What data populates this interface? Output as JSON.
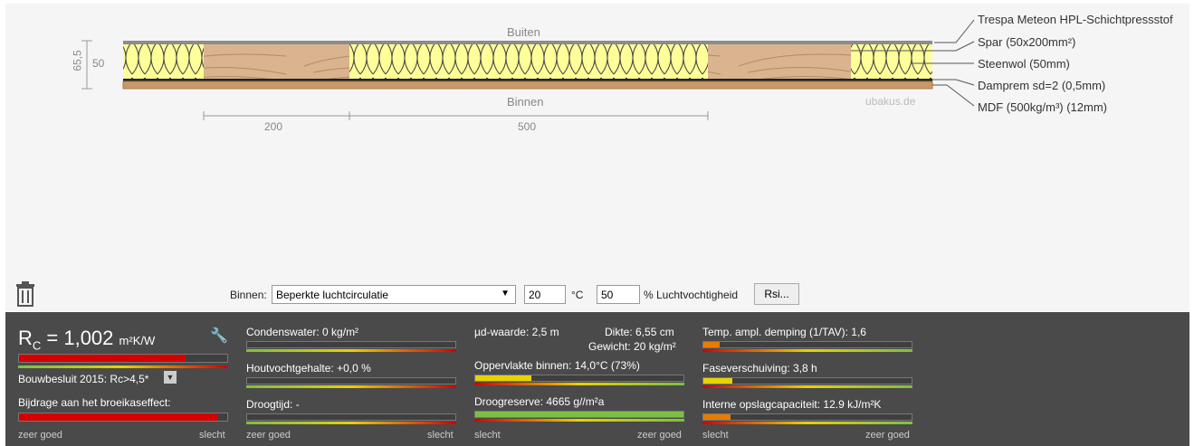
{
  "diagram": {
    "top_label": "Buiten",
    "bottom_label": "Binnen",
    "watermark": "ubakus.de",
    "dim_height_total": "65,5",
    "dim_height_layer": "50",
    "dim_widths": [
      "200",
      "500"
    ],
    "layers": [
      "Trespa Meteon HPL-Schichtpressstof",
      "Spar (50x200mm²)",
      "Steenwol (50mm)",
      "Damprem sd=2 (0,5mm)",
      "MDF (500kg/m³) (12mm)"
    ]
  },
  "controls": {
    "binnen_label": "Binnen:",
    "air_select": "Beperkte luchtcirculatie",
    "temp_value": "20",
    "temp_unit": "°C",
    "humidity_value": "50",
    "humidity_unit": "% Luchtvochtigheid",
    "rsi_button": "Rsi..."
  },
  "results": {
    "rc_prefix": "R",
    "rc_sub": "C",
    "rc_value": " = 1,002",
    "rc_unit": "m²K/W",
    "norm": "Bouwbesluit 2015: Rc>4,5*",
    "greenhouse": "Bijdrage aan het broeikaseffect:",
    "scale_left_1": "zeer goed",
    "scale_right_1": "slecht",
    "condensation": "Condenswater: 0 kg/m²",
    "wood_moisture": "Houtvochtgehalte: +0,0 %",
    "drying_time": "Droogtijd: -",
    "scale_left_2": "zeer goed",
    "scale_right_2": "slecht",
    "mu_value": "µd-waarde: 2,5 m",
    "thickness": "Dikte: 6,55 cm",
    "weight": "Gewicht: 20 kg/m²",
    "surface_inside": "Oppervlakte binnen: 14,0°C (73%)",
    "drying_reserve": "Droogreserve: 4665 g//m²a",
    "scale_left_3": "slecht",
    "scale_right_3": "zeer goed",
    "temp_ampl": "Temp. ampl. demping (1/TAV): 1,6",
    "phase_shift": "Faseverschuiving: 3,8 h",
    "heat_capacity": "Interne opslagcapaciteit: 12.9 kJ/m²K",
    "scale_left_4": "slecht",
    "scale_right_4": "zeer goed"
  },
  "levels": {
    "rc": 0.8,
    "greenhouse": 0.95,
    "condensation": 0.0,
    "wood_moisture": 0.0,
    "drying_time": 0.0,
    "surface_inside": 0.27,
    "drying_reserve": 1.0,
    "temp_ampl": 0.08,
    "phase_shift": 0.14,
    "heat_capacity": 0.13
  },
  "colors": {
    "footer_bg": "#4a4a4a",
    "insulation": "#ffff99",
    "wood": "#d9b48f",
    "bar_red": "#d40000",
    "bar_yellow": "#e8d200",
    "bar_orange": "#e87b00",
    "bar_green": "#7cc043"
  },
  "icons": [
    "trash-icon",
    "wrench-icon",
    "dropdown-icon"
  ]
}
